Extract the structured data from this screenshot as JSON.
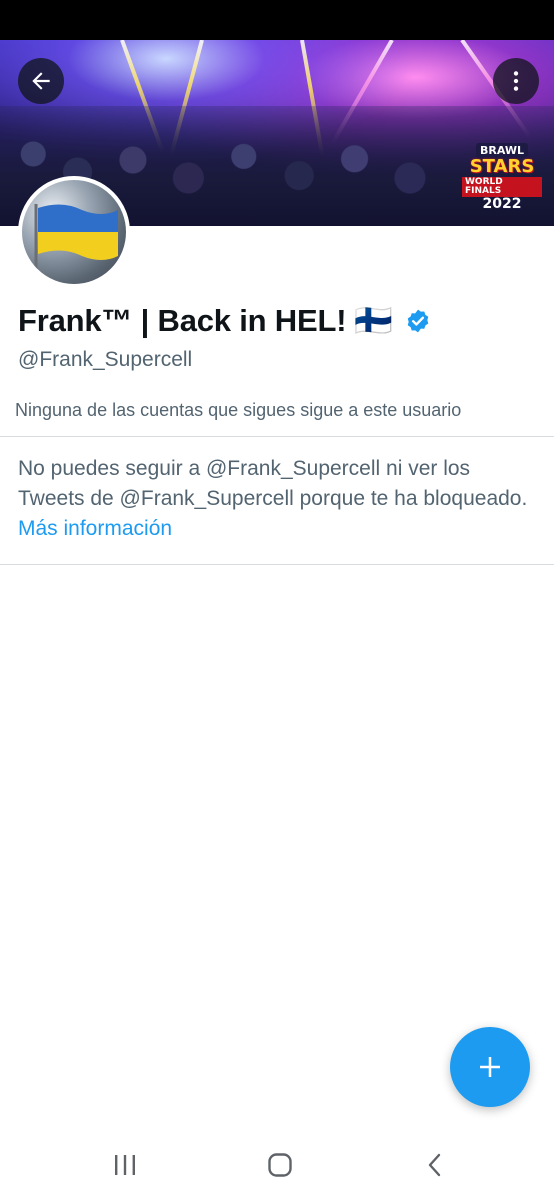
{
  "profile": {
    "display_name": "Frank™ | Back in HEL!",
    "name_emoji": "🇫🇮",
    "handle": "@Frank_Supercell",
    "verified": true,
    "followers_note": "Ninguna de las cuentas que sigues sigue a este usuario"
  },
  "banner": {
    "logo_line1": "BRAWL",
    "logo_line2": "STARS",
    "logo_line3": "WORLD FINALS",
    "logo_line4": "2022"
  },
  "blocked": {
    "message": "No puedes seguir a @Frank_Supercell ni ver los Tweets de @Frank_Supercell porque te ha bloqueado.",
    "link_text": "Más información"
  },
  "icons": {
    "back": "arrow-left-icon",
    "more": "more-vertical-icon",
    "verified": "verified-badge-icon",
    "compose": "plus-icon",
    "nav_recents": "recents-icon",
    "nav_home": "home-icon",
    "nav_back": "back-chevron-icon"
  },
  "colors": {
    "accent": "#1d9bf0",
    "secondary_text": "#536471",
    "primary_text": "#0f1419"
  }
}
